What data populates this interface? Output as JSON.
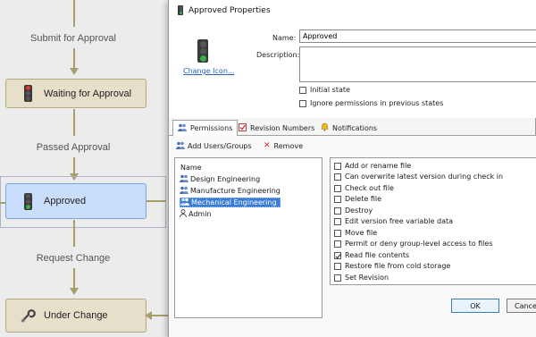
{
  "workflow": {
    "transitions": [
      {
        "label": "Submit for Approval"
      },
      {
        "label": "Passed Approval"
      },
      {
        "label": "Request Change"
      }
    ],
    "states": [
      {
        "label": "Waiting for Approval",
        "icon": "traffic-light-red"
      },
      {
        "label": "Approved",
        "icon": "traffic-light-green"
      },
      {
        "label": "Under Change",
        "icon": "wrench-icon"
      }
    ]
  },
  "dialog": {
    "title": "Approved Properties",
    "name_label": "Name:",
    "name_value": "Approved",
    "description_label": "Description:",
    "description_value": "",
    "change_icon_link": "Change Icon...",
    "initial_state_label": "Initial state",
    "initial_state_checked": false,
    "ignore_perms_label": "Ignore permissions in previous states",
    "ignore_perms_checked": false,
    "tabs": [
      {
        "label": "Permissions",
        "icon": "users-icon",
        "active": true
      },
      {
        "label": "Revision Numbers",
        "icon": "revision-icon",
        "active": false
      },
      {
        "label": "Notifications",
        "icon": "bell-icon",
        "active": false
      }
    ],
    "add_users_label": "Add Users/Groups",
    "remove_label": "Remove",
    "list_header": "Name",
    "groups": [
      {
        "label": "Design Engineering",
        "icon": "group-icon",
        "selected": false
      },
      {
        "label": "Manufacture Engineering",
        "icon": "group-icon",
        "selected": false
      },
      {
        "label": "Mechanical Engineering",
        "icon": "group-icon",
        "selected": true
      },
      {
        "label": "Admin",
        "icon": "user-icon",
        "selected": false
      }
    ],
    "permissions": [
      {
        "label": "Add or rename file",
        "checked": false
      },
      {
        "label": "Can overwrite latest version during check in",
        "checked": false
      },
      {
        "label": "Check out file",
        "checked": false
      },
      {
        "label": "Delete file",
        "checked": false
      },
      {
        "label": "Destroy",
        "checked": false
      },
      {
        "label": "Edit version free variable data",
        "checked": false
      },
      {
        "label": "Move file",
        "checked": false
      },
      {
        "label": "Permit or deny group-level access to files",
        "checked": false
      },
      {
        "label": "Read file contents",
        "checked": true
      },
      {
        "label": "Restore file from cold storage",
        "checked": false
      },
      {
        "label": "Set Revision",
        "checked": false
      }
    ],
    "ok_label": "OK",
    "cancel_label": "Cance"
  },
  "colors": {
    "state_fill": "#e6dfc9",
    "state_selected_fill": "#c9defa",
    "selection_blue": "#3a7bd5",
    "link_blue": "#2a62b8"
  }
}
